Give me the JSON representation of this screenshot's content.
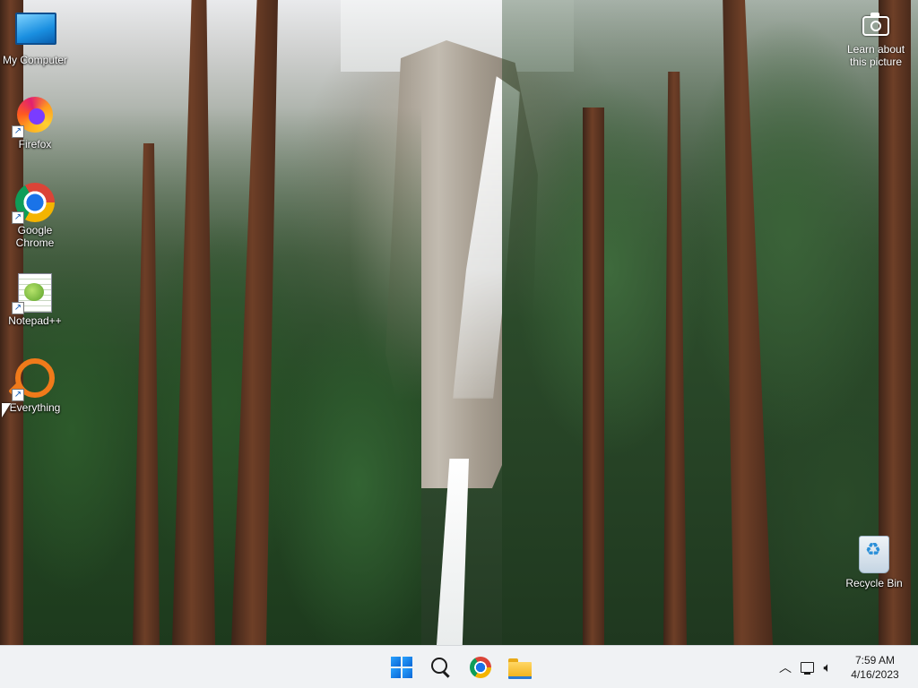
{
  "desktop": {
    "icons": [
      {
        "label": "My Computer",
        "icon": "computer-icon"
      },
      {
        "label": "Firefox",
        "icon": "firefox-icon",
        "shortcut": true
      },
      {
        "label": "Google Chrome",
        "icon": "chrome-icon",
        "shortcut": true
      },
      {
        "label": "Notepad++",
        "icon": "notepadpp-icon",
        "shortcut": true
      },
      {
        "label": "Everything",
        "icon": "everything-icon",
        "shortcut": true
      }
    ],
    "recycle_bin": {
      "label": "Recycle Bin",
      "icon": "recycle-bin-icon"
    },
    "spotlight": {
      "label": "Learn about this picture",
      "icon": "camera-icon"
    }
  },
  "taskbar": {
    "pinned": [
      {
        "name": "Start",
        "icon": "windows-icon"
      },
      {
        "name": "Search",
        "icon": "search-icon"
      },
      {
        "name": "Google Chrome",
        "icon": "chrome-icon"
      },
      {
        "name": "File Explorer",
        "icon": "folder-icon"
      }
    ],
    "tray": {
      "overflow_icon": "chevron-up-icon",
      "network_icon": "network-icon",
      "volume_icon": "volume-icon",
      "time": "7:59 AM",
      "date": "4/16/2023"
    }
  },
  "colors": {
    "taskbar_bg": "#f0f2f4",
    "windows_blue": "#0b67d6",
    "firefox_orange": "#ff5a1f",
    "everything_orange": "#f07a1a"
  }
}
